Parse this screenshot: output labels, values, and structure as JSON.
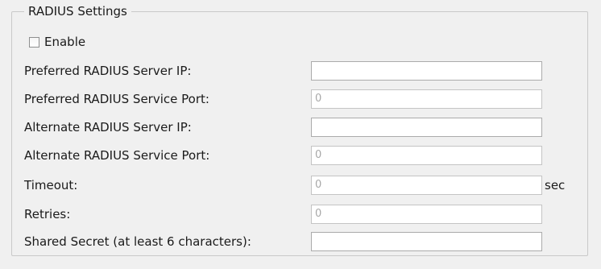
{
  "group_title": "RADIUS Settings",
  "enable_label": "Enable",
  "fields": [
    {
      "label": "Preferred RADIUS Server IP:",
      "value": ""
    },
    {
      "label": "Preferred RADIUS Service Port:",
      "value": "0"
    },
    {
      "label": "Alternate RADIUS Server IP:",
      "value": ""
    },
    {
      "label": "Alternate RADIUS Service Port:",
      "value": "0"
    },
    {
      "label": "Timeout:",
      "value": "0",
      "unit": "sec"
    },
    {
      "label": "Retries:",
      "value": "0"
    },
    {
      "label": "Shared Secret (at least 6 characters):",
      "value": ""
    }
  ]
}
